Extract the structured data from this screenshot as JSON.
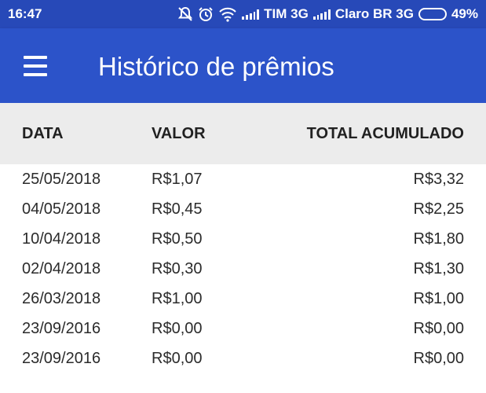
{
  "status_bar": {
    "time": "16:47",
    "carrier1": "TIM 3G",
    "carrier2": "Claro BR 3G",
    "battery_percent": "49%",
    "battery_level": 0.49,
    "icons": [
      "notifications-off-icon",
      "alarm-icon",
      "wifi-icon",
      "signal-icon",
      "battery-icon"
    ]
  },
  "app_bar": {
    "title": "Histórico de prêmios",
    "menu_icon": "menu-icon"
  },
  "table": {
    "headers": {
      "date": "DATA",
      "value": "VALOR",
      "total": "TOTAL ACUMULADO"
    },
    "rows": [
      {
        "date": "25/05/2018",
        "value": "R$1,07",
        "total": "R$3,32"
      },
      {
        "date": "04/05/2018",
        "value": "R$0,45",
        "total": "R$2,25"
      },
      {
        "date": "10/04/2018",
        "value": "R$0,50",
        "total": "R$1,80"
      },
      {
        "date": "02/04/2018",
        "value": "R$0,30",
        "total": "R$1,30"
      },
      {
        "date": "26/03/2018",
        "value": "R$1,00",
        "total": "R$1,00"
      },
      {
        "date": "23/09/2016",
        "value": "R$0,00",
        "total": "R$0,00"
      },
      {
        "date": "23/09/2016",
        "value": "R$0,00",
        "total": "R$0,00"
      }
    ]
  },
  "colors": {
    "status_bar": "#2749b8",
    "app_bar": "#2c53c9",
    "header_bg": "#ececec",
    "battery_fill": "#f3a01c"
  }
}
